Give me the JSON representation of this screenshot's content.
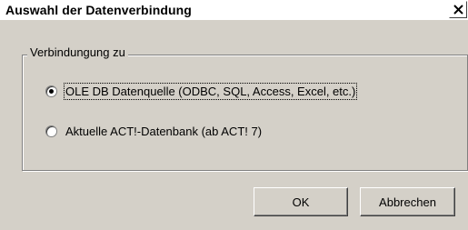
{
  "window": {
    "title": "Auswahl der Datenverbindung",
    "close_icon": "close-icon"
  },
  "group": {
    "legend": "Verbindungung zu",
    "options": [
      {
        "label": "OLE DB Datenquelle (ODBC, SQL, Access, Excel, etc.)",
        "selected": true
      },
      {
        "label": "Aktuelle ACT!-Datenbank (ab ACT! 7)",
        "selected": false
      }
    ]
  },
  "buttons": {
    "ok_label": "OK",
    "cancel_label": "Abbrechen"
  }
}
